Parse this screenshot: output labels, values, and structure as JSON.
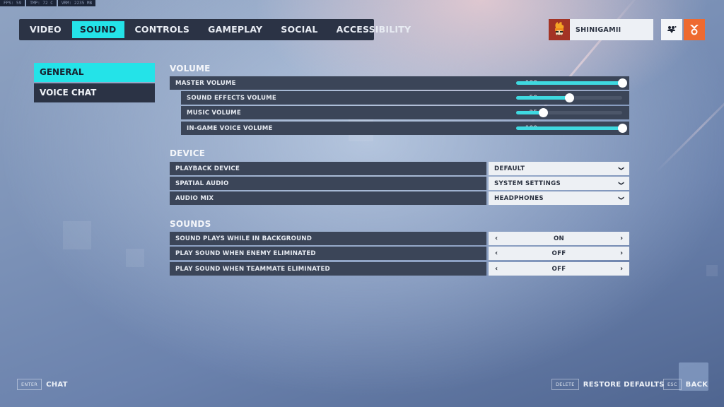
{
  "perf_overlay": {
    "fps": "FPS: 59",
    "temp": "TMP: 72 C",
    "vram": "VRM: 2235 MB"
  },
  "topnav": {
    "tabs": [
      {
        "label": "VIDEO",
        "active": false
      },
      {
        "label": "SOUND",
        "active": true
      },
      {
        "label": "CONTROLS",
        "active": false
      },
      {
        "label": "GAMEPLAY",
        "active": false
      },
      {
        "label": "SOCIAL",
        "active": false
      },
      {
        "label": "ACCESSIBILITY",
        "active": false
      }
    ]
  },
  "profile": {
    "username": "SHINIGAMII",
    "avatar_icon": "hero-portrait-icon",
    "social_icon": "friends-icon",
    "reward_icon": "medal-icon"
  },
  "sidebar": {
    "items": [
      {
        "label": "GENERAL",
        "active": true
      },
      {
        "label": "VOICE CHAT",
        "active": false
      }
    ]
  },
  "volume": {
    "title": "VOLUME",
    "sliders": [
      {
        "label": "MASTER VOLUME",
        "value": 100,
        "max": 100
      },
      {
        "label": "SOUND EFFECTS VOLUME",
        "value": 50,
        "max": 100
      },
      {
        "label": "MUSIC VOLUME",
        "value": 25,
        "max": 100
      },
      {
        "label": "IN-GAME VOICE VOLUME",
        "value": 100,
        "max": 100
      }
    ]
  },
  "device": {
    "title": "DEVICE",
    "settings": [
      {
        "label": "PLAYBACK DEVICE",
        "value": "DEFAULT"
      },
      {
        "label": "SPATIAL AUDIO",
        "value": "SYSTEM SETTINGS"
      },
      {
        "label": "AUDIO MIX",
        "value": "HEADPHONES"
      }
    ]
  },
  "sounds": {
    "title": "SOUNDS",
    "settings": [
      {
        "label": "SOUND PLAYS WHILE IN BACKGROUND",
        "value": "ON"
      },
      {
        "label": "PLAY SOUND WHEN ENEMY ELIMINATED",
        "value": "OFF"
      },
      {
        "label": "PLAY SOUND WHEN TEAMMATE ELIMINATED",
        "value": "OFF"
      }
    ]
  },
  "footer": {
    "chat": {
      "key": "ENTER",
      "label": "CHAT"
    },
    "restore": {
      "key": "DELETE",
      "label": "RESTORE DEFAULTS"
    },
    "back": {
      "key": "ESC",
      "label": "BACK"
    }
  },
  "colors": {
    "accent": "#24e3e8",
    "panel": "#2b3345",
    "row": "#3b4558",
    "reward": "#ee6a30"
  }
}
